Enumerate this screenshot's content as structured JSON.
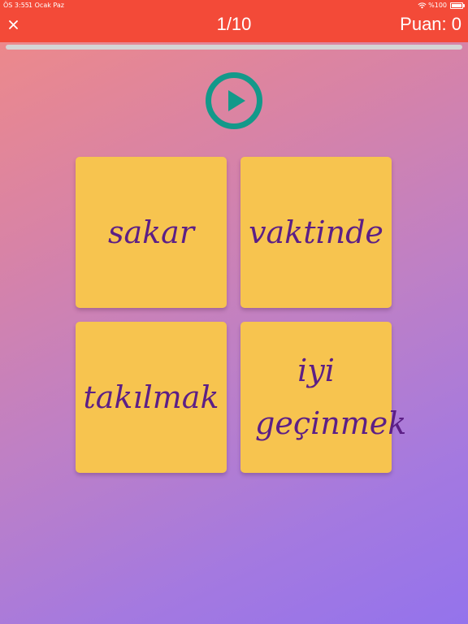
{
  "status_bar": {
    "time": "ÖS 3:55",
    "date": "1 Ocak Paz",
    "battery": "%100"
  },
  "header": {
    "counter": "1/10",
    "score": "Puan: 0"
  },
  "progress": {
    "fraction": 0.0
  },
  "colors": {
    "header_bg": "#f34a38",
    "card_bg": "#f7c44f",
    "card_text": "#5c1f86",
    "play_button": "#13998a"
  },
  "cards": [
    {
      "label": "sakar"
    },
    {
      "label": "vaktinde"
    },
    {
      "label": "takılmak"
    },
    {
      "label": "iyi geçinmek"
    }
  ]
}
